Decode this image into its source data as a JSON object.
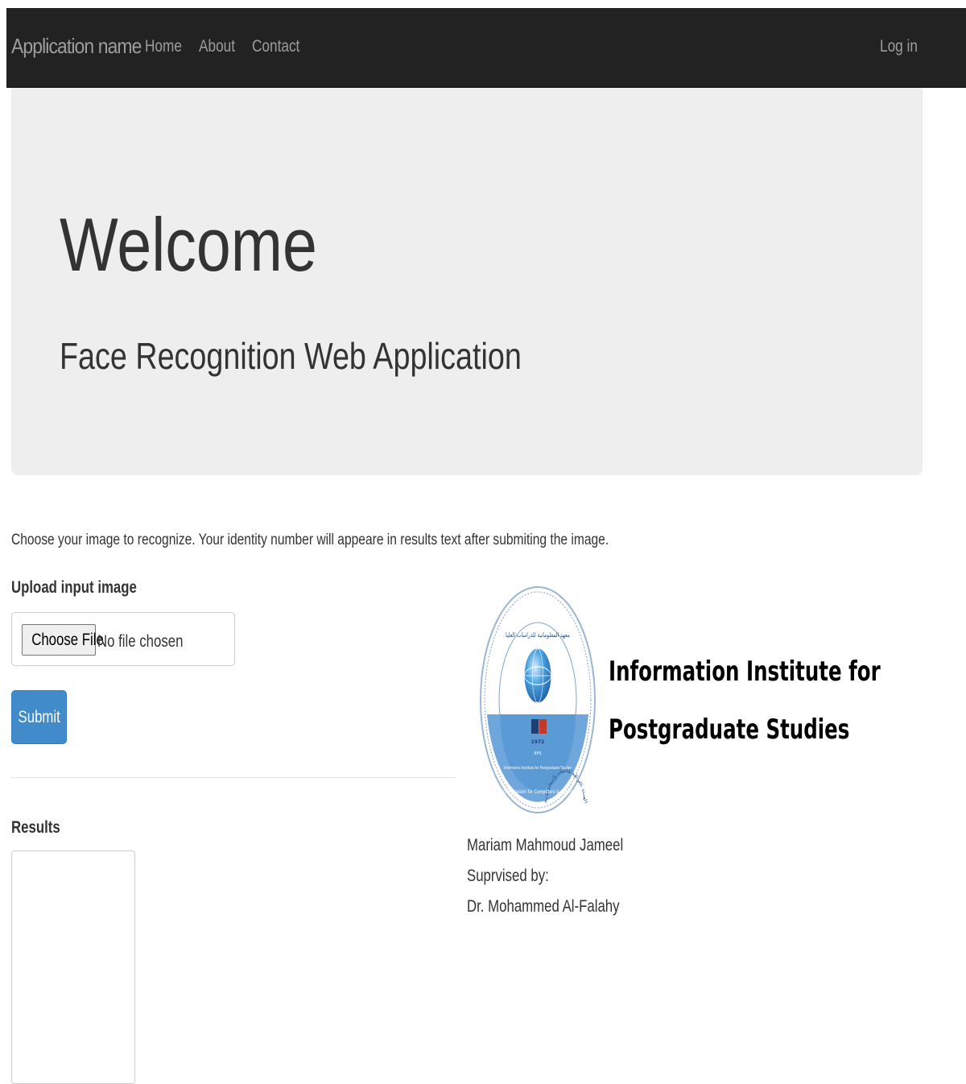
{
  "navbar": {
    "brand": "Application name",
    "links": [
      "Home",
      "About",
      "Contact"
    ],
    "login": "Log in"
  },
  "jumbotron": {
    "title": "Welcome",
    "subtitle": "Face Recognition Web Application"
  },
  "form": {
    "instructions": "Choose your image to recognize. Your identity number will appeare in results text after submiting the image.",
    "upload_label": "Upload input image",
    "choose_file_label": "Choose File",
    "file_status": "No file chosen",
    "submit_label": "Submit",
    "results_label": "Results",
    "results_value": ""
  },
  "institute": {
    "name_line1": "Information Institute for",
    "name_line2": "Postgraduate Studies",
    "seal_icon": "institute-seal-logo",
    "seal_text_ar": "الهيئة العراقية للحاسبات والمعلوماتية",
    "seal_text_ar2": "معهد المعلوماتية للدراسات العليا",
    "seal_text_en": "Iraqi Commission for Computers & Informatics",
    "seal_text_en2": "Informatics Institute for Postgraduate Studies",
    "seal_letters": "IIPS",
    "seal_year": "1972"
  },
  "credits": {
    "author": "Mariam Mahmoud Jameel",
    "supervised_label": "Suprvised by:",
    "supervisor": "Dr. Mohammed Al-Falahy"
  },
  "colors": {
    "navbar_bg": "#222222",
    "nav_text": "#9d9d9d",
    "jumbotron_bg": "#eeeeee",
    "primary_button": "#428bca",
    "seal_blue": "#5b9bd5"
  }
}
